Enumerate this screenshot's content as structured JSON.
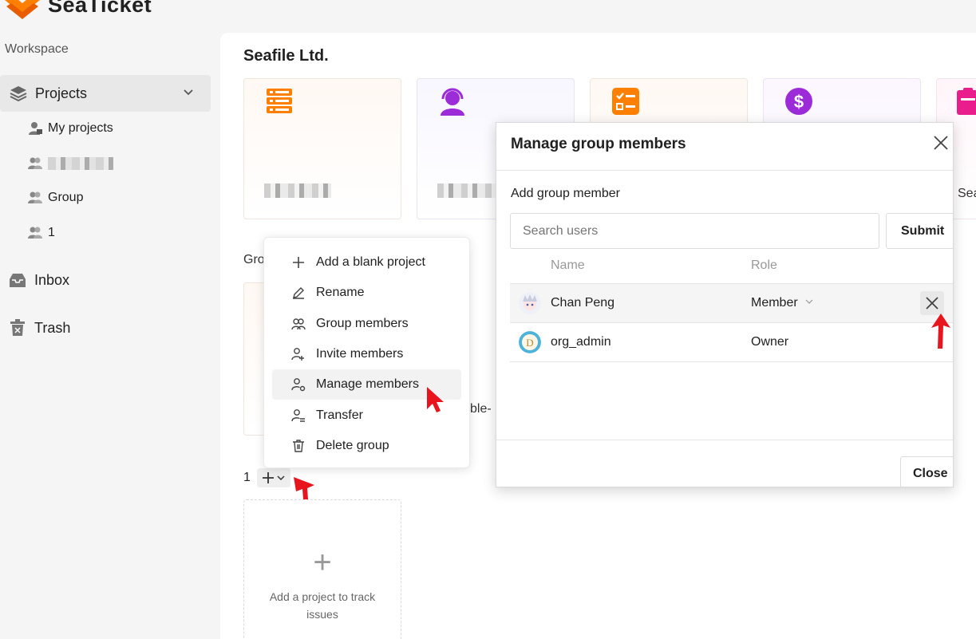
{
  "app": {
    "name": "SeaTicket"
  },
  "sidebar": {
    "workspace_label": "Workspace",
    "projects_label": "Projects",
    "sub_items": [
      {
        "label": "My projects"
      },
      {
        "label": ""
      },
      {
        "label": "Group"
      },
      {
        "label": "1"
      }
    ],
    "inbox_label": "Inbox",
    "trash_label": "Trash"
  },
  "main": {
    "org_title": "Seafile Ltd.",
    "section_label": "Gro",
    "partial_text": "ble-",
    "card_partial_label": "Sea",
    "group_name": "1",
    "add_card_text": "Add a project to track issues"
  },
  "dropdown": {
    "items": [
      {
        "label": "Add a blank project",
        "icon": "plus-icon"
      },
      {
        "label": "Rename",
        "icon": "pencil-icon"
      },
      {
        "label": "Group members",
        "icon": "users-icon"
      },
      {
        "label": "Invite members",
        "icon": "user-plus-icon"
      },
      {
        "label": "Manage members",
        "icon": "user-gear-icon"
      },
      {
        "label": "Transfer",
        "icon": "user-transfer-icon"
      },
      {
        "label": "Delete group",
        "icon": "trash-icon"
      }
    ]
  },
  "modal": {
    "title": "Manage group members",
    "add_label": "Add group member",
    "search_placeholder": "Search users",
    "submit_label": "Submit",
    "col_name": "Name",
    "col_role": "Role",
    "members": [
      {
        "name": "Chan Peng",
        "role": "Member"
      },
      {
        "name": "org_admin",
        "role": "Owner"
      }
    ],
    "close_label": "Close"
  },
  "colors": {
    "brand_orange": "#ff8000",
    "purple": "#9c2bd8",
    "magenta": "#e91e8c",
    "cursor_red": "#e8141e"
  }
}
